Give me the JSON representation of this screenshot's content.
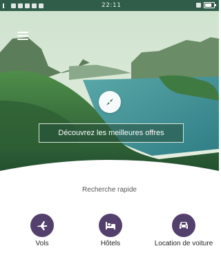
{
  "status_bar": {
    "time": "22:11"
  },
  "hero": {
    "menu_icon": "hamburger-menu-icon",
    "compass_icon": "compass-icon",
    "cta_label": "Découvrez les meilleures offres"
  },
  "quick_search": {
    "title": "Recherche rapide",
    "items": [
      {
        "label": "Vols",
        "icon": "airplane-icon"
      },
      {
        "label": "Hôtels",
        "icon": "bed-icon"
      },
      {
        "label": "Location de voiture",
        "icon": "car-icon"
      }
    ]
  },
  "colors": {
    "accent": "#54406c",
    "status_bar": "#2f5d4a",
    "text": "#222222",
    "subtle_text": "#555555"
  }
}
